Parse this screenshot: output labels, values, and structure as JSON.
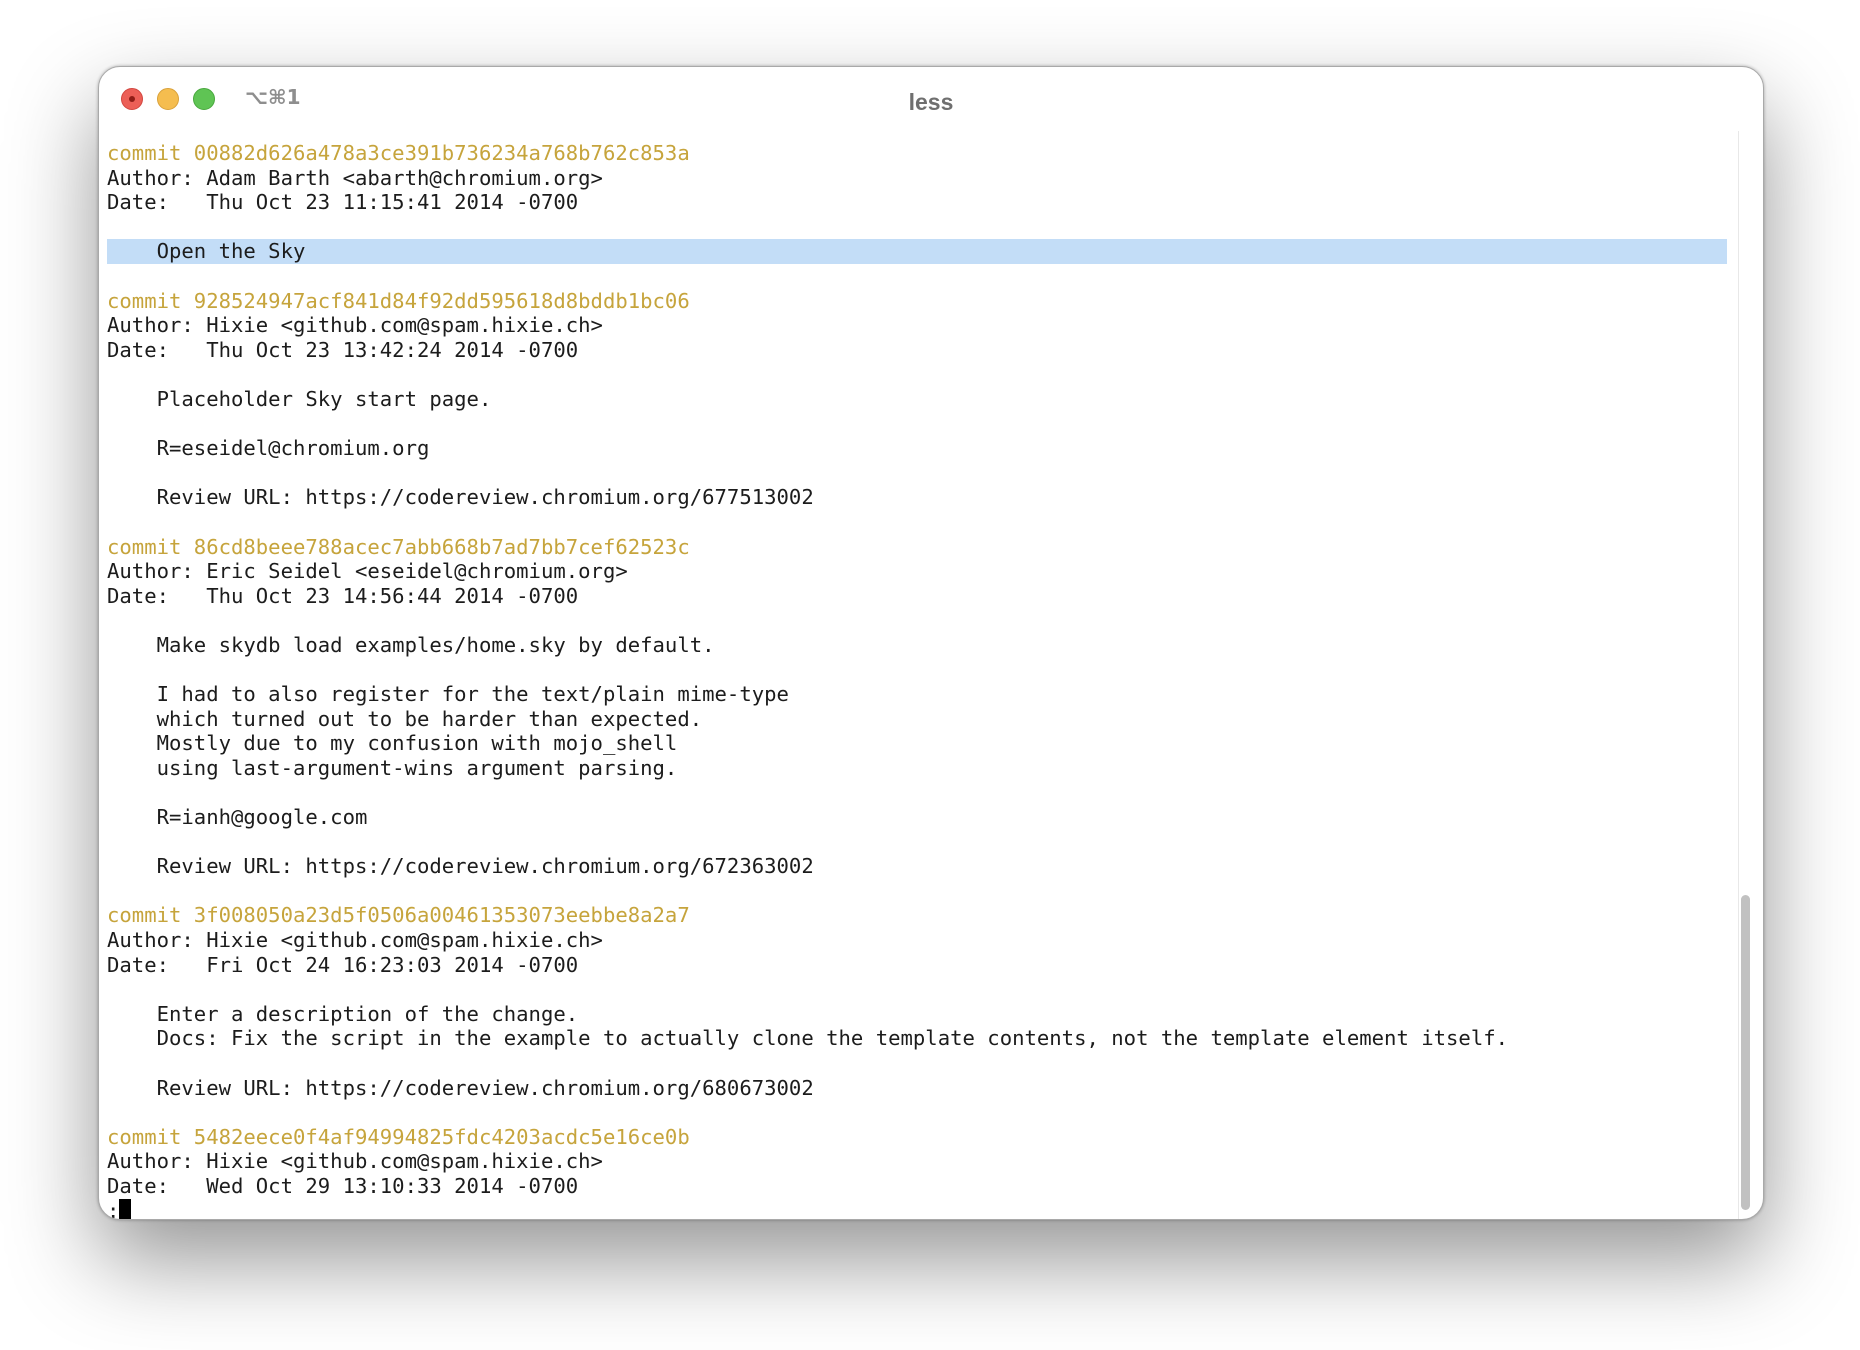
{
  "window": {
    "title": "less",
    "shortcut": "⌥⌘1"
  },
  "colors": {
    "commit_hash": "#c6a43c",
    "selection": "#c3ddf7",
    "text": "#1c1c1c"
  },
  "terminal": {
    "lines": [
      {
        "text": "commit 00882d626a478a3ce391b736234a768b762c853a",
        "type": "commit"
      },
      {
        "text": "Author: Adam Barth <abarth@chromium.org>",
        "type": "text"
      },
      {
        "text": "Date:   Thu Oct 23 11:15:41 2014 -0700",
        "type": "text"
      },
      {
        "text": "",
        "type": "text"
      },
      {
        "text": "    Open the Sky",
        "type": "selected"
      },
      {
        "text": "",
        "type": "text"
      },
      {
        "text": "commit 928524947acf841d84f92dd595618d8bddb1bc06",
        "type": "commit"
      },
      {
        "text": "Author: Hixie <github.com@spam.hixie.ch>",
        "type": "text"
      },
      {
        "text": "Date:   Thu Oct 23 13:42:24 2014 -0700",
        "type": "text"
      },
      {
        "text": "",
        "type": "text"
      },
      {
        "text": "    Placeholder Sky start page.",
        "type": "text"
      },
      {
        "text": "",
        "type": "text"
      },
      {
        "text": "    R=eseidel@chromium.org",
        "type": "text"
      },
      {
        "text": "",
        "type": "text"
      },
      {
        "text": "    Review URL: https://codereview.chromium.org/677513002",
        "type": "text"
      },
      {
        "text": "",
        "type": "text"
      },
      {
        "text": "commit 86cd8beee788acec7abb668b7ad7bb7cef62523c",
        "type": "commit"
      },
      {
        "text": "Author: Eric Seidel <eseidel@chromium.org>",
        "type": "text"
      },
      {
        "text": "Date:   Thu Oct 23 14:56:44 2014 -0700",
        "type": "text"
      },
      {
        "text": "",
        "type": "text"
      },
      {
        "text": "    Make skydb load examples/home.sky by default.",
        "type": "text"
      },
      {
        "text": "",
        "type": "text"
      },
      {
        "text": "    I had to also register for the text/plain mime-type",
        "type": "text"
      },
      {
        "text": "    which turned out to be harder than expected.",
        "type": "text"
      },
      {
        "text": "    Mostly due to my confusion with mojo_shell",
        "type": "text"
      },
      {
        "text": "    using last-argument-wins argument parsing.",
        "type": "text"
      },
      {
        "text": "",
        "type": "text"
      },
      {
        "text": "    R=ianh@google.com",
        "type": "text"
      },
      {
        "text": "",
        "type": "text"
      },
      {
        "text": "    Review URL: https://codereview.chromium.org/672363002",
        "type": "text"
      },
      {
        "text": "",
        "type": "text"
      },
      {
        "text": "commit 3f008050a23d5f0506a00461353073eebbe8a2a7",
        "type": "commit"
      },
      {
        "text": "Author: Hixie <github.com@spam.hixie.ch>",
        "type": "text"
      },
      {
        "text": "Date:   Fri Oct 24 16:23:03 2014 -0700",
        "type": "text"
      },
      {
        "text": "",
        "type": "text"
      },
      {
        "text": "    Enter a description of the change.",
        "type": "text"
      },
      {
        "text": "    Docs: Fix the script in the example to actually clone the template contents, not the template element itself.",
        "type": "text"
      },
      {
        "text": "",
        "type": "text"
      },
      {
        "text": "    Review URL: https://codereview.chromium.org/680673002",
        "type": "text"
      },
      {
        "text": "",
        "type": "text"
      },
      {
        "text": "commit 5482eece0f4af94994825fdc4203acdc5e16ce0b",
        "type": "commit"
      },
      {
        "text": "Author: Hixie <github.com@spam.hixie.ch>",
        "type": "text"
      },
      {
        "text": "Date:   Wed Oct 29 13:10:33 2014 -0700",
        "type": "text"
      }
    ],
    "prompt": ":"
  },
  "scrollbar": {
    "position": 0.72,
    "visible_fraction": 0.29
  }
}
